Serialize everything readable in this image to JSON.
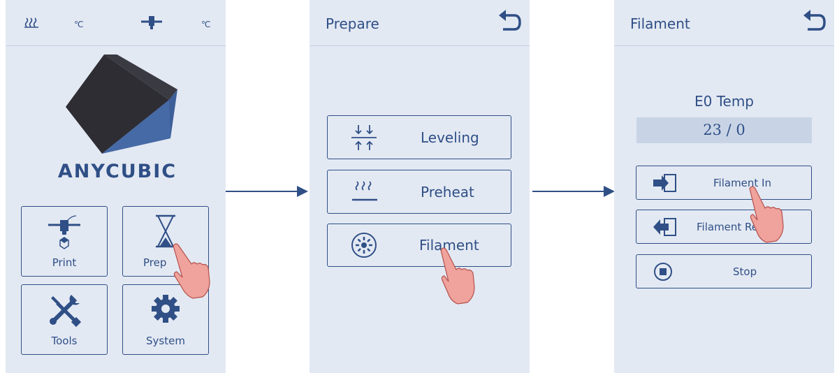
{
  "main_screen": {
    "status": {
      "hotbed_unit": "℃",
      "nozzle_unit": "℃"
    },
    "logo_text": "ANYCUBIC",
    "tiles": [
      {
        "label": "Print",
        "icon": "print-icon"
      },
      {
        "label": "Prep",
        "icon": "hourglass-icon"
      },
      {
        "label": "Tools",
        "icon": "tools-icon"
      },
      {
        "label": "System",
        "icon": "gear-icon"
      }
    ]
  },
  "prepare_screen": {
    "title": "Prepare",
    "back_icon": "back-arrow-icon",
    "buttons": [
      {
        "label": "Leveling",
        "icon": "leveling-icon"
      },
      {
        "label": "Preheat",
        "icon": "heat-icon"
      },
      {
        "label": "Filament",
        "icon": "filament-spool-icon"
      }
    ]
  },
  "filament_screen": {
    "title": "Filament",
    "back_icon": "back-arrow-icon",
    "temp_label": "E0 Temp",
    "temp_value": "23 / 0",
    "buttons": [
      {
        "label": "Filament In",
        "icon": "filament-in-icon"
      },
      {
        "label": "Filament Re",
        "tail": "e",
        "icon": "filament-remove-icon"
      },
      {
        "label": "Stop",
        "icon": "stop-icon"
      }
    ]
  },
  "colors": {
    "panel_bg": "#e3e9f3",
    "accent": "#2f4f86",
    "hand": "#f0a29c",
    "temp_bg": "#c8d4e6"
  }
}
